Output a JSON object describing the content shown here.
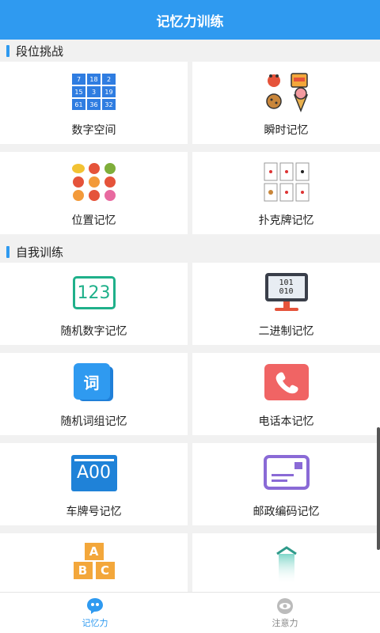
{
  "header": {
    "title": "记忆力训练"
  },
  "sections": [
    {
      "label": "段位挑战"
    },
    {
      "label": "自我训练"
    }
  ],
  "cards": {
    "digit_space": {
      "label": "数字空间",
      "grid": [
        "7",
        "18",
        "2",
        "15",
        "3",
        "19",
        "61",
        "36",
        "32"
      ]
    },
    "instant_memory": {
      "label": "瞬时记忆"
    },
    "position_memory": {
      "label": "位置记忆"
    },
    "poker_memory": {
      "label": "扑克牌记忆"
    },
    "random_number": {
      "label": "随机数字记忆",
      "icon_text": "123"
    },
    "binary_memory": {
      "label": "二进制记忆",
      "icon_text_1": "101",
      "icon_text_2": "010"
    },
    "random_words": {
      "label": "随机词组记忆",
      "icon_text": "词"
    },
    "phone_memory": {
      "label": "电话本记忆"
    },
    "plate_memory": {
      "label": "车牌号记忆",
      "icon_text": "A00"
    },
    "postal_memory": {
      "label": "邮政编码记忆"
    },
    "abc": {
      "letters": [
        "A",
        "B",
        "C"
      ]
    }
  },
  "bottom_nav": {
    "memory": {
      "label": "记忆力",
      "color": "#2f9af0"
    },
    "attention": {
      "label": "注意力",
      "color": "#888888"
    }
  }
}
